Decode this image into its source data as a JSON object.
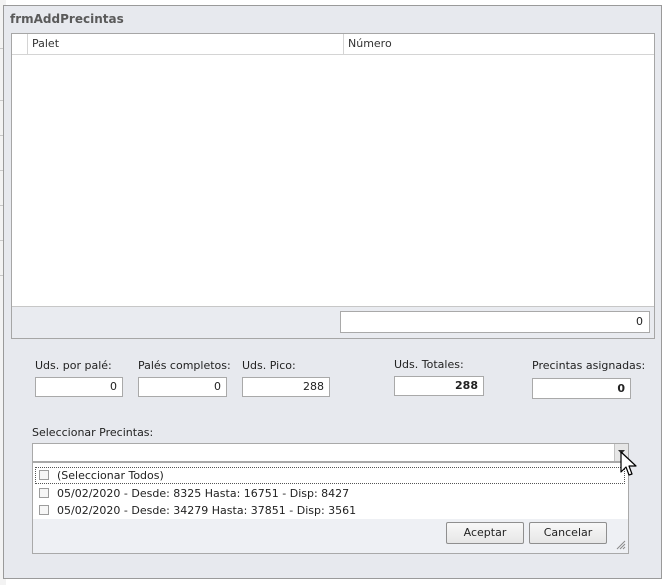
{
  "window": {
    "title": "frmAddPrecintas"
  },
  "grid": {
    "columns": [
      "Palet",
      "Número"
    ],
    "footer_total": "0"
  },
  "fields": [
    {
      "label": "Uds. por palé:",
      "value": "0"
    },
    {
      "label": "Palés completos:",
      "value": "0"
    },
    {
      "label": "Uds. Pico:",
      "value": "288"
    },
    {
      "label": "Uds. Totales:",
      "value": "288"
    },
    {
      "label": "Precintas asignadas:",
      "value": "0"
    }
  ],
  "selector": {
    "label": "Seleccionar Precintas:",
    "value": "",
    "items": [
      {
        "label": "(Seleccionar Todos)",
        "checked": false
      },
      {
        "label": "05/02/2020 - Desde: 8325 Hasta: 16751 - Disp: 8427",
        "checked": false
      },
      {
        "label": "05/02/2020 - Desde: 34279 Hasta: 37851 - Disp: 3561",
        "checked": false
      }
    ],
    "ok_label": "Aceptar",
    "cancel_label": "Cancelar"
  }
}
